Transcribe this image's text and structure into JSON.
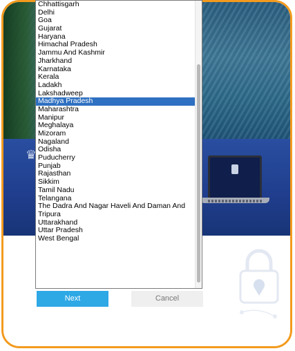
{
  "states_dropdown": {
    "options": [
      "Chhattisgarh",
      "Delhi",
      "Goa",
      "Gujarat",
      "Haryana",
      "Himachal Pradesh",
      "Jammu And Kashmir",
      "Jharkhand",
      "Karnataka",
      "Kerala",
      "Ladakh",
      "Lakshadweep",
      "Madhya Pradesh",
      "Maharashtra",
      "Manipur",
      "Meghalaya",
      "Mizoram",
      "Nagaland",
      "Odisha",
      "Puducherry",
      "Punjab",
      "Rajasthan",
      "Sikkim",
      "Tamil Nadu",
      "Telangana",
      "The Dadra And Nagar Haveli And Daman And",
      "Tripura",
      "Uttarakhand",
      "Uttar Pradesh",
      "West Bengal"
    ],
    "selected": "Madhya Pradesh"
  },
  "buttons": {
    "next_label": "Next",
    "cancel_label": "Cancel"
  },
  "colors": {
    "frame_border": "#f39a1e",
    "selected_option": "#2e70c1",
    "next_button": "#2fa8e6",
    "cancel_button": "#efefef",
    "band": "#1f3d8c"
  },
  "icons": {
    "emblem": "national-emblem-icon",
    "lock": "padlock-location-icon"
  }
}
